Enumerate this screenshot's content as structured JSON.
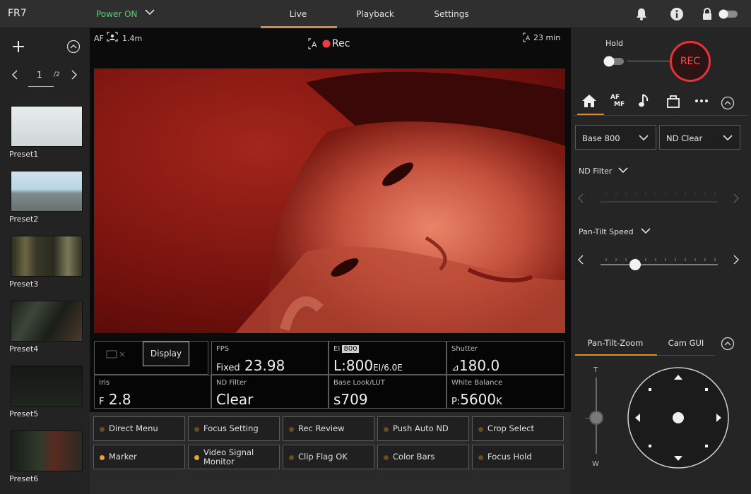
{
  "header": {
    "app_title": "FR7",
    "power_label": "Power ON",
    "tabs": [
      {
        "label": "Live",
        "active": true
      },
      {
        "label": "Playback",
        "active": false
      },
      {
        "label": "Settings",
        "active": false
      }
    ],
    "accent_color": "#e38b1f",
    "power_color": "#4fd36b",
    "icons": [
      "bell-icon",
      "info-icon",
      "lock-icon",
      "toggle-switch"
    ]
  },
  "presets": {
    "page_current": "1",
    "page_total": "/2",
    "items": [
      {
        "label": "Preset1"
      },
      {
        "label": "Preset2"
      },
      {
        "label": "Preset3"
      },
      {
        "label": "Preset4"
      },
      {
        "label": "Preset5"
      },
      {
        "label": "Preset6"
      }
    ]
  },
  "monitor": {
    "af_label": "AF",
    "focus_distance": "1.4m",
    "rec_label": "Rec",
    "remaining_time": "23 min",
    "display_button": "Display",
    "status": {
      "fps": {
        "label": "FPS",
        "prefix": "Fixed",
        "value": "23.98"
      },
      "ei": {
        "label": "EI",
        "badge": "800",
        "value": "L:800",
        "suffix": "EI/6.0E"
      },
      "shutter": {
        "label": "Shutter",
        "prefix": "⊿",
        "value": "180.0"
      },
      "iris": {
        "label": "Iris",
        "prefix": "F",
        "value": "2.8"
      },
      "nd_filter": {
        "label": "ND Filter",
        "value": "Clear"
      },
      "base_look": {
        "label": "Base Look/LUT",
        "value": "s709"
      },
      "white_balance": {
        "label": "White Balance",
        "prefix": "P:",
        "value": "5600",
        "suffix": "K"
      }
    }
  },
  "assign_buttons": [
    {
      "label": "Direct Menu",
      "active": false
    },
    {
      "label": "Focus Setting",
      "active": false
    },
    {
      "label": "Rec Review",
      "active": false
    },
    {
      "label": "Push Auto ND",
      "active": false
    },
    {
      "label": "Crop Select",
      "active": false
    },
    {
      "label": "Marker",
      "active": true
    },
    {
      "label": "Video Signal Monitor",
      "line1": "Video Signal",
      "line2": "Monitor",
      "active": true
    },
    {
      "label": "Clip Flag OK",
      "active": false
    },
    {
      "label": "Color Bars",
      "active": false
    },
    {
      "label": "Focus Hold",
      "active": false
    }
  ],
  "right_panel": {
    "hold_label": "Hold",
    "rec_button": "REC",
    "rec_color": "#e8313a",
    "icon_tabs": [
      "home-icon",
      "af-mf-icon",
      "audio-icon",
      "media-icon",
      "more-icon"
    ],
    "af_mf_top": "AF",
    "af_mf_bottom": "MF",
    "base_dropdown": "Base 800",
    "nd_dropdown": "ND Clear",
    "nd_filter_label": "ND Filter",
    "pan_tilt_speed_label": "Pan-Tilt Speed",
    "pan_tilt_speed_level": 0.27,
    "ptz_tabs": [
      {
        "label": "Pan-Tilt-Zoom",
        "active": true
      },
      {
        "label": "Cam GUI",
        "active": false
      }
    ],
    "zoom_tele": "T",
    "zoom_wide": "W"
  }
}
